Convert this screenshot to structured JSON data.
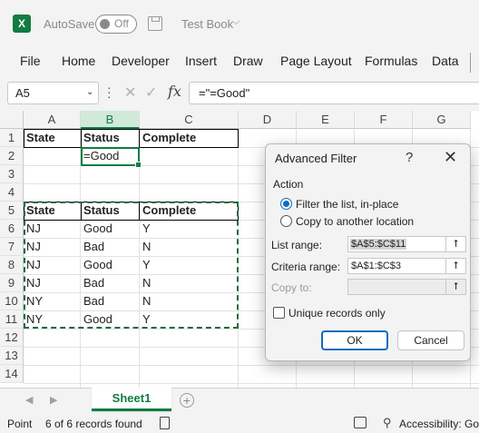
{
  "titlebar": {
    "logo": "X",
    "autosave_label": "AutoSave",
    "autosave_state": "Off",
    "book_title": "Test Book",
    "book_chevron": "⌵"
  },
  "menu": [
    "File",
    "Home",
    "Developer",
    "Insert",
    "Draw",
    "Page Layout",
    "Formulas",
    "Data"
  ],
  "formula_bar": {
    "name_box": "A5",
    "formula": "=\"=Good\"",
    "fx_label": "fx"
  },
  "grid": {
    "columns": [
      "A",
      "B",
      "C",
      "D",
      "E",
      "F",
      "G"
    ],
    "selected_column": "B",
    "rows": [
      "1",
      "2",
      "3",
      "4",
      "5",
      "6",
      "7",
      "8",
      "9",
      "10",
      "11",
      "12",
      "13",
      "14"
    ],
    "cells": {
      "A1": "State",
      "B1": "Status",
      "C1": "Complete",
      "B2": "=Good",
      "A5": "State",
      "B5": "Status",
      "C5": "Complete",
      "A6": "NJ",
      "B6": "Good",
      "C6": "Y",
      "A7": "NJ",
      "B7": "Bad",
      "C7": "N",
      "A8": "NJ",
      "B8": "Good",
      "C8": "Y",
      "A9": "NJ",
      "B9": "Bad",
      "C9": "N",
      "A10": "NY",
      "B10": "Bad",
      "C10": "N",
      "A11": "NY",
      "B11": "Good",
      "C11": "Y"
    }
  },
  "sheets": {
    "active": "Sheet1",
    "add_label": "+"
  },
  "status": {
    "mode": "Point",
    "records": "6 of 6 records found",
    "accessibility": "Accessibility: Goo"
  },
  "dialog": {
    "title": "Advanced Filter",
    "help": "?",
    "close": "✕",
    "action_label": "Action",
    "option_inplace": "Filter the list, in-place",
    "option_copy": "Copy to another location",
    "selected_option": "inplace",
    "list_range_label": "List range:",
    "list_range_value": "$A$5:$C$11",
    "criteria_range_label": "Criteria range:",
    "criteria_range_value": "$A$1:$C$3",
    "copy_to_label": "Copy to:",
    "unique_label": "Unique records only",
    "unique_checked": false,
    "ok": "OK",
    "cancel": "Cancel"
  }
}
